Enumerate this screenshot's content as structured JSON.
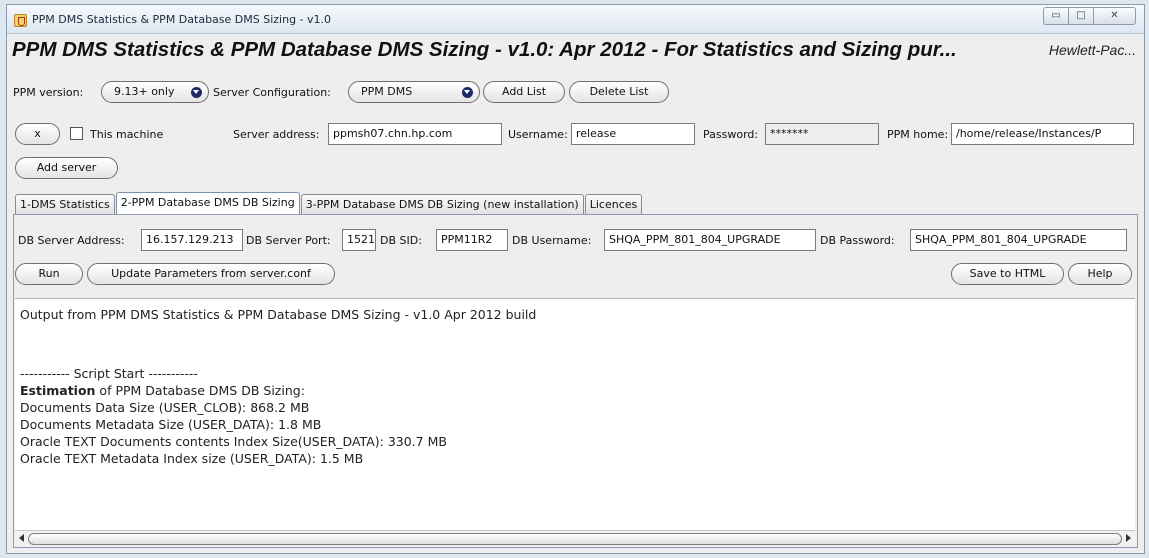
{
  "window": {
    "title": "PPM DMS Statistics & PPM Database DMS Sizing - v1.0",
    "min_glyph": "▭",
    "max_glyph": "□",
    "close_glyph": "✕"
  },
  "header": {
    "headline": "PPM DMS Statistics & PPM Database DMS Sizing - v1.0: Apr 2012 - For Statistics and Sizing pur...",
    "vendor": "Hewlett-Pac..."
  },
  "toolbar": {
    "ppm_version_label": "PPM version:",
    "ppm_version_value": "9.13+ only",
    "server_config_label": "Server Configuration:",
    "server_config_value": "PPM DMS",
    "add_list": "Add List",
    "delete_list": "Delete List"
  },
  "server": {
    "remove_label": "x",
    "this_machine_label": "This machine",
    "address_label": "Server address:",
    "address_value": "ppmsh07.chn.hp.com",
    "username_label": "Username:",
    "username_value": "release",
    "password_label": "Password:",
    "password_value": "*******",
    "ppm_home_label": "PPM home:",
    "ppm_home_value": "/home/release/Instances/P",
    "add_server": "Add server"
  },
  "tabs": [
    {
      "label": "1-DMS Statistics",
      "active": false
    },
    {
      "label": "2-PPM Database DMS DB Sizing",
      "active": true
    },
    {
      "label": "3-PPM Database DMS DB Sizing (new installation)",
      "active": false
    },
    {
      "label": "Licences",
      "active": false
    }
  ],
  "db": {
    "address_label": "DB Server Address:",
    "address_value": "16.157.129.213",
    "port_label": "DB Server Port:",
    "port_value": "1521",
    "sid_label": "DB SID:",
    "sid_value": "PPM11R2",
    "username_label": "DB Username:",
    "username_value": "SHQA_PPM_801_804_UPGRADE",
    "password_label": "DB Password:",
    "password_value": "SHQA_PPM_801_804_UPGRADE"
  },
  "actions": {
    "run": "Run",
    "update_params": "Update Parameters from server.conf",
    "save_html": "Save to HTML",
    "help": "Help"
  },
  "output": {
    "header": "Output from PPM DMS Statistics & PPM Database DMS Sizing - v1.0 Apr 2012 build",
    "script_start": "----------- Script Start -----------",
    "estimation_bold": "Estimation",
    "estimation_rest": " of PPM Database DMS DB Sizing:",
    "lines": [
      "Documents Data Size (USER_CLOB): 868.2 MB",
      "Documents Metadata Size (USER_DATA): 1.8 MB",
      "Oracle TEXT Documents contents Index Size(USER_DATA): 330.7 MB",
      "Oracle TEXT Metadata Index size (USER_DATA): 1.5 MB"
    ]
  },
  "colors": {
    "titlebar": "#dde6f1",
    "window_bg": "#eeeeee",
    "combo_arrow": "#1c2c68"
  }
}
